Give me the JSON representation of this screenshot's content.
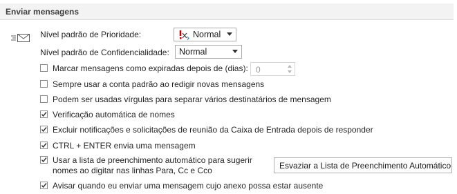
{
  "section": {
    "title": "Enviar mensagens"
  },
  "icon": "send-message-icon",
  "priority": {
    "label": "Nível padrão de Prioridade:",
    "value": "Normal",
    "icon": "priority-flag-icon"
  },
  "sensitivity": {
    "label": "Nível padrão de Confidencialidade:",
    "value": "Normal"
  },
  "expire": {
    "label": "Marcar mensagens como expiradas depois de (dias):",
    "checked": false,
    "days": "0"
  },
  "options": [
    {
      "label": "Sempre usar a conta padrão ao redigir novas mensagens",
      "checked": false
    },
    {
      "label": "Podem ser usadas vírgulas para separar vários destinatários de mensagem",
      "checked": false
    },
    {
      "label": "Verificação automática de nomes",
      "checked": true
    },
    {
      "label": "Excluir notificações e solicitações de reunião da Caixa de Entrada depois de responder",
      "checked": true
    },
    {
      "label": "CTRL + ENTER envia uma mensagem",
      "checked": true
    }
  ],
  "autocomplete": {
    "line1": "Usar a lista de preenchimento automático para sugerir",
    "line2": "nomes ao digitar nas linhas Para, Cc e Cco",
    "checked": true,
    "button_label": "Esvaziar a Lista de Preenchimento Automático"
  },
  "attachment_warning": {
    "label": "Avisar quando eu enviar uma mensagem cujo anexo possa estar ausente",
    "checked": true
  }
}
